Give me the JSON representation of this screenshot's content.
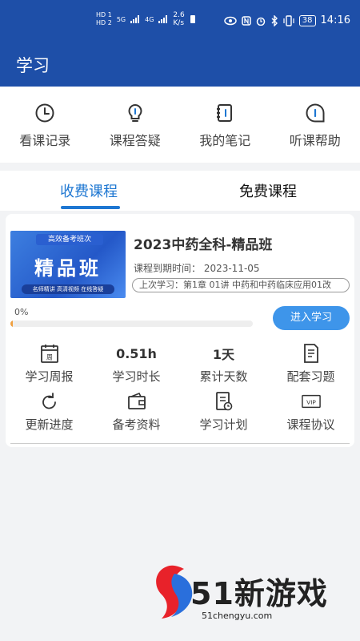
{
  "status_bar": {
    "net_left": "HD 1\nHD 2",
    "signal1": "5G",
    "signal2": "4G",
    "speed_value": "2.6",
    "speed_unit": "K/s",
    "battery": "38",
    "time": "14:16"
  },
  "app_bar": {
    "title": "学习"
  },
  "quick_actions": [
    {
      "label": "看课记录",
      "icon": "clock-icon"
    },
    {
      "label": "课程答疑",
      "icon": "lightbulb-icon"
    },
    {
      "label": "我的笔记",
      "icon": "notebook-icon"
    },
    {
      "label": "听课帮助",
      "icon": "info-icon"
    }
  ],
  "tabs": {
    "active": "收费课程",
    "inactive": "免费课程"
  },
  "course": {
    "thumb_ribbon": "高效备考班次",
    "thumb_big": "精品班",
    "thumb_bar": "名师精讲 高清视频 在线答疑",
    "title": "2023中药全科-精品班",
    "expiry": "课程到期时间：  2023-11-05",
    "last_study": "上次学习：第1章 01讲 中药和中药临床应用01改",
    "progress_label": "0%",
    "progress_value": 0.01,
    "enter_button": "进入学习"
  },
  "stats_row1": [
    {
      "icon": "calendar-week-icon",
      "icon_text": "周",
      "label": "学习周报"
    },
    {
      "value": "0.51h",
      "label": "学习时长"
    },
    {
      "value": "1天",
      "label": "累计天数"
    },
    {
      "icon": "exercise-doc-icon",
      "label": "配套习题"
    }
  ],
  "stats_row2": [
    {
      "icon": "refresh-icon",
      "label": "更新进度"
    },
    {
      "icon": "wallet-icon",
      "label": "备考资料"
    },
    {
      "icon": "plan-icon",
      "label": "学习计划"
    },
    {
      "icon": "vip-icon",
      "icon_text": "VIP",
      "label": "课程协议"
    }
  ],
  "watermark": {
    "brand": "51新游戏",
    "url": "51chengyu.com"
  },
  "colors": {
    "primary": "#1e4fa8",
    "accent": "#1e77d2",
    "button": "#3e95ea"
  }
}
